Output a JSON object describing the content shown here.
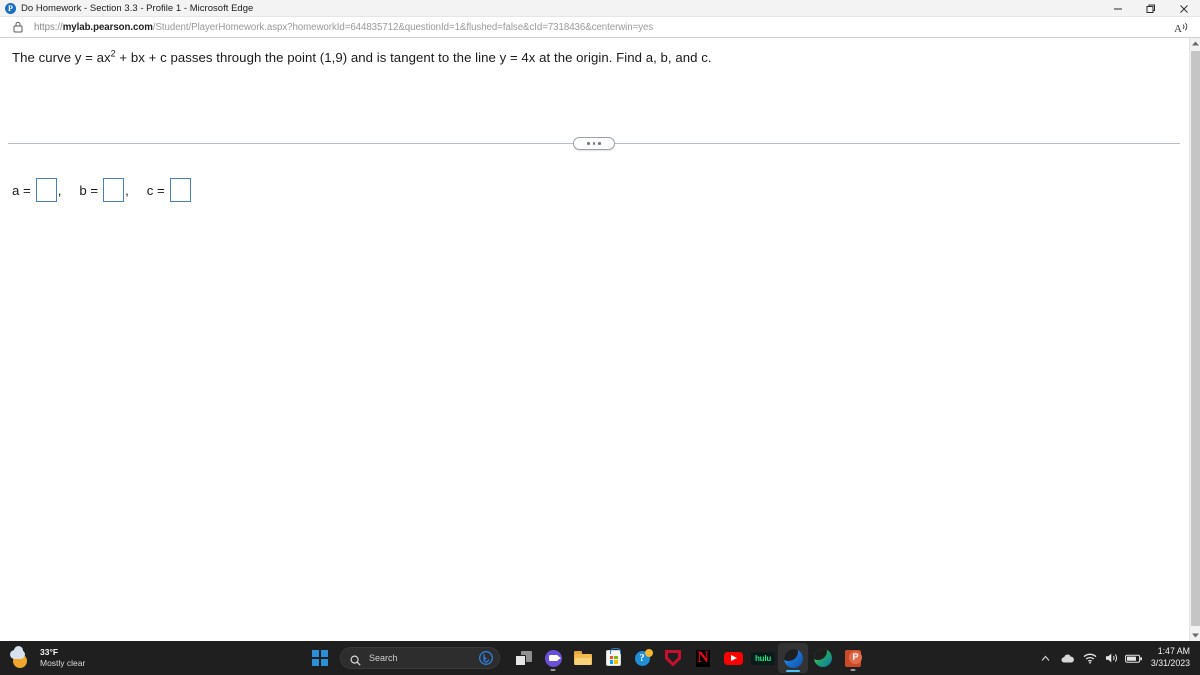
{
  "browser": {
    "window_title": "Do Homework - Section 3.3 - Profile 1 - Microsoft Edge",
    "favicon_letter": "P",
    "url_protocol": "https://",
    "url_domain": "mylab.pearson.com",
    "url_path": "/Student/PlayerHomework.aspx?homeworkId=644835712&questionId=1&flushed=false&cId=7318436&centerwin=yes",
    "url_full": "https://mylab.pearson.com/Student/PlayerHomework.aspx?homeworkId=644835712&questionId=1&flushed=false&cId=7318436&centerwin=yes",
    "read_aloud_label": "A",
    "minimize_label": "—",
    "restore_label": "❐",
    "close_label": "✕"
  },
  "question": {
    "prefix": "The curve y = ax",
    "exponent": "2",
    "suffix": " + bx + c passes through the point (1,9) and is tangent to the line y = 4x at the origin. Find a, b, and c.",
    "full_text": "The curve y = ax2 + bx + c passes through the point (1,9) and is tangent to the line y = 4x at the origin. Find a, b, and c."
  },
  "answers": {
    "a_label": "a =",
    "a_value": "",
    "separator_1": ",",
    "b_label": "b =",
    "b_value": "",
    "separator_2": ",",
    "c_label": "c =",
    "c_value": "",
    "input_border_color": "#4a7ebb"
  },
  "taskbar": {
    "weather": {
      "temperature": "33°F",
      "condition": "Mostly clear"
    },
    "search": {
      "placeholder": "Search"
    },
    "apps": [
      {
        "name": "task-view",
        "label": "Task View"
      },
      {
        "name": "microsoft-teams",
        "label": "Microsoft Teams"
      },
      {
        "name": "file-explorer",
        "label": "File Explorer"
      },
      {
        "name": "microsoft-store",
        "label": "Microsoft Store"
      },
      {
        "name": "get-help",
        "label": "Get Help"
      },
      {
        "name": "mcafee",
        "label": "McAfee"
      },
      {
        "name": "netflix",
        "label": "Netflix"
      },
      {
        "name": "youtube",
        "label": "YouTube"
      },
      {
        "name": "hulu",
        "label": "hulu"
      },
      {
        "name": "microsoft-edge",
        "label": "Microsoft Edge"
      },
      {
        "name": "microsoft-edge-dev",
        "label": "Microsoft Edge Dev"
      },
      {
        "name": "powerpoint",
        "label": "PowerPoint"
      }
    ],
    "netflix_glyph": "N",
    "hulu_glyph": "hulu",
    "help_glyph": "?",
    "ppt_glyph": "P",
    "tray": {
      "overflow_label": "˄",
      "time": "1:47 AM",
      "date": "3/31/2023"
    }
  },
  "scrollbar": {
    "up_arrow": "▲",
    "down_arrow": "▼"
  }
}
